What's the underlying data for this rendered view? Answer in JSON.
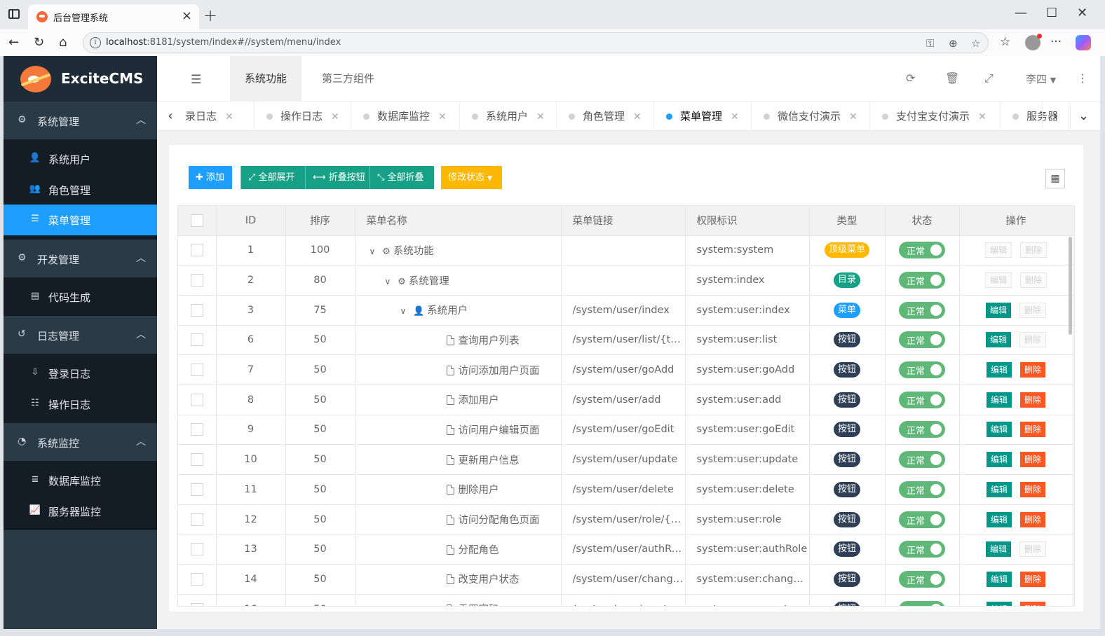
{
  "browser": {
    "tab_title": "后台管理系统",
    "url_host": "localhost",
    "url_rest": ":8181/system/index#//system/menu/index"
  },
  "app": {
    "logo_text": "ExciteCMS",
    "sidebar": [
      {
        "label": "系统管理",
        "icon": "gear-icon",
        "items": [
          {
            "label": "系统用户",
            "icon": "user-icon"
          },
          {
            "label": "角色管理",
            "icon": "users-icon"
          },
          {
            "label": "菜单管理",
            "icon": "list-icon",
            "active": true
          }
        ]
      },
      {
        "label": "开发管理",
        "icon": "gears-icon",
        "items": [
          {
            "label": "代码生成",
            "icon": "file-code-icon"
          }
        ]
      },
      {
        "label": "日志管理",
        "icon": "history-icon",
        "items": [
          {
            "label": "登录日志",
            "icon": "login-icon"
          },
          {
            "label": "操作日志",
            "icon": "sliders-icon"
          }
        ]
      },
      {
        "label": "系统监控",
        "icon": "dashboard-icon",
        "items": [
          {
            "label": "数据库监控",
            "icon": "database-icon"
          },
          {
            "label": "服务器监控",
            "icon": "chart-icon"
          }
        ]
      }
    ],
    "header": {
      "tabs": [
        "系统功能",
        "第三方组件"
      ],
      "user_name": "李四"
    },
    "page_tabs": [
      "录日志",
      "操作日志",
      "数据库监控",
      "系统用户",
      "角色管理",
      "菜单管理",
      "微信支付演示",
      "支付宝支付演示",
      "服务器"
    ],
    "toolbar": {
      "add": "添加",
      "expand_all": "全部展开",
      "fold_button": "折叠按钮",
      "collapse_all": "全部折叠",
      "change_status": "修改状态"
    },
    "table": {
      "columns": [
        "ID",
        "排序",
        "菜单名称",
        "菜单链接",
        "权限标识",
        "类型",
        "状态",
        "操作"
      ],
      "status_label": "正常",
      "edit_label": "编辑",
      "delete_label": "删除",
      "rows": [
        {
          "id": "1",
          "sort": "100",
          "name": "系统功能",
          "level": 0,
          "icon": "gears-icon",
          "expandable": true,
          "link": "",
          "perm": "system:system",
          "type": "顶级菜单",
          "type_kind": "top",
          "edit": false,
          "del": false
        },
        {
          "id": "2",
          "sort": "80",
          "name": "系统管理",
          "level": 1,
          "icon": "gear-icon",
          "expandable": true,
          "link": "",
          "perm": "system:index",
          "type": "目录",
          "type_kind": "dir",
          "edit": false,
          "del": false
        },
        {
          "id": "3",
          "sort": "75",
          "name": "系统用户",
          "level": 2,
          "icon": "user-icon",
          "expandable": true,
          "link": "/system/user/index",
          "perm": "system:user:index",
          "type": "菜单",
          "type_kind": "menu",
          "edit": true,
          "del": false
        },
        {
          "id": "6",
          "sort": "50",
          "name": "查询用户列表",
          "level": 3,
          "icon": "file-icon",
          "expandable": false,
          "link": "/system/user/list/{type}",
          "perm": "system:user:list",
          "type": "按钮",
          "type_kind": "btn",
          "edit": true,
          "del": false
        },
        {
          "id": "7",
          "sort": "50",
          "name": "访问添加用户页面",
          "level": 3,
          "icon": "file-icon",
          "expandable": false,
          "link": "/system/user/goAdd",
          "perm": "system:user:goAdd",
          "type": "按钮",
          "type_kind": "btn",
          "edit": true,
          "del": true
        },
        {
          "id": "8",
          "sort": "50",
          "name": "添加用户",
          "level": 3,
          "icon": "file-icon",
          "expandable": false,
          "link": "/system/user/add",
          "perm": "system:user:add",
          "type": "按钮",
          "type_kind": "btn",
          "edit": true,
          "del": true
        },
        {
          "id": "9",
          "sort": "50",
          "name": "访问用户编辑页面",
          "level": 3,
          "icon": "file-icon",
          "expandable": false,
          "link": "/system/user/goEdit",
          "perm": "system:user:goEdit",
          "type": "按钮",
          "type_kind": "btn",
          "edit": true,
          "del": true
        },
        {
          "id": "10",
          "sort": "50",
          "name": "更新用户信息",
          "level": 3,
          "icon": "file-icon",
          "expandable": false,
          "link": "/system/user/update",
          "perm": "system:user:update",
          "type": "按钮",
          "type_kind": "btn",
          "edit": true,
          "del": true
        },
        {
          "id": "11",
          "sort": "50",
          "name": "删除用户",
          "level": 3,
          "icon": "file-icon",
          "expandable": false,
          "link": "/system/user/delete",
          "perm": "system:user:delete",
          "type": "按钮",
          "type_kind": "btn",
          "edit": true,
          "del": true
        },
        {
          "id": "12",
          "sort": "50",
          "name": "访问分配角色页面",
          "level": 3,
          "icon": "file-icon",
          "expandable": false,
          "link": "/system/user/role/{userId}",
          "perm": "system:user:role",
          "type": "按钮",
          "type_kind": "btn",
          "edit": true,
          "del": true
        },
        {
          "id": "13",
          "sort": "50",
          "name": "分配角色",
          "level": 3,
          "icon": "file-icon",
          "expandable": false,
          "link": "/system/user/authRole",
          "perm": "system:user:authRole",
          "type": "按钮",
          "type_kind": "btn",
          "edit": true,
          "del": false
        },
        {
          "id": "14",
          "sort": "50",
          "name": "改变用户状态",
          "level": 3,
          "icon": "file-icon",
          "expandable": false,
          "link": "/system/user/changeStatus",
          "perm": "system:user:changeStatus",
          "type": "按钮",
          "type_kind": "btn",
          "edit": true,
          "del": true
        },
        {
          "id": "16",
          "sort": "50",
          "name": "重置密码",
          "level": 3,
          "icon": "file-icon",
          "expandable": false,
          "link": "/system/user/reset",
          "perm": "system:user:reset",
          "type": "按钮",
          "type_kind": "btn",
          "edit": true,
          "del": true
        }
      ]
    }
  },
  "colors": {
    "sidebar_bg": "#2b3a47",
    "sidebar_sub_bg": "#141d26",
    "accent_blue": "#1e9fff",
    "teal": "#16a085",
    "orange": "#ffb800",
    "switch_green": "#5fb878",
    "delete_red": "#ff5722"
  }
}
